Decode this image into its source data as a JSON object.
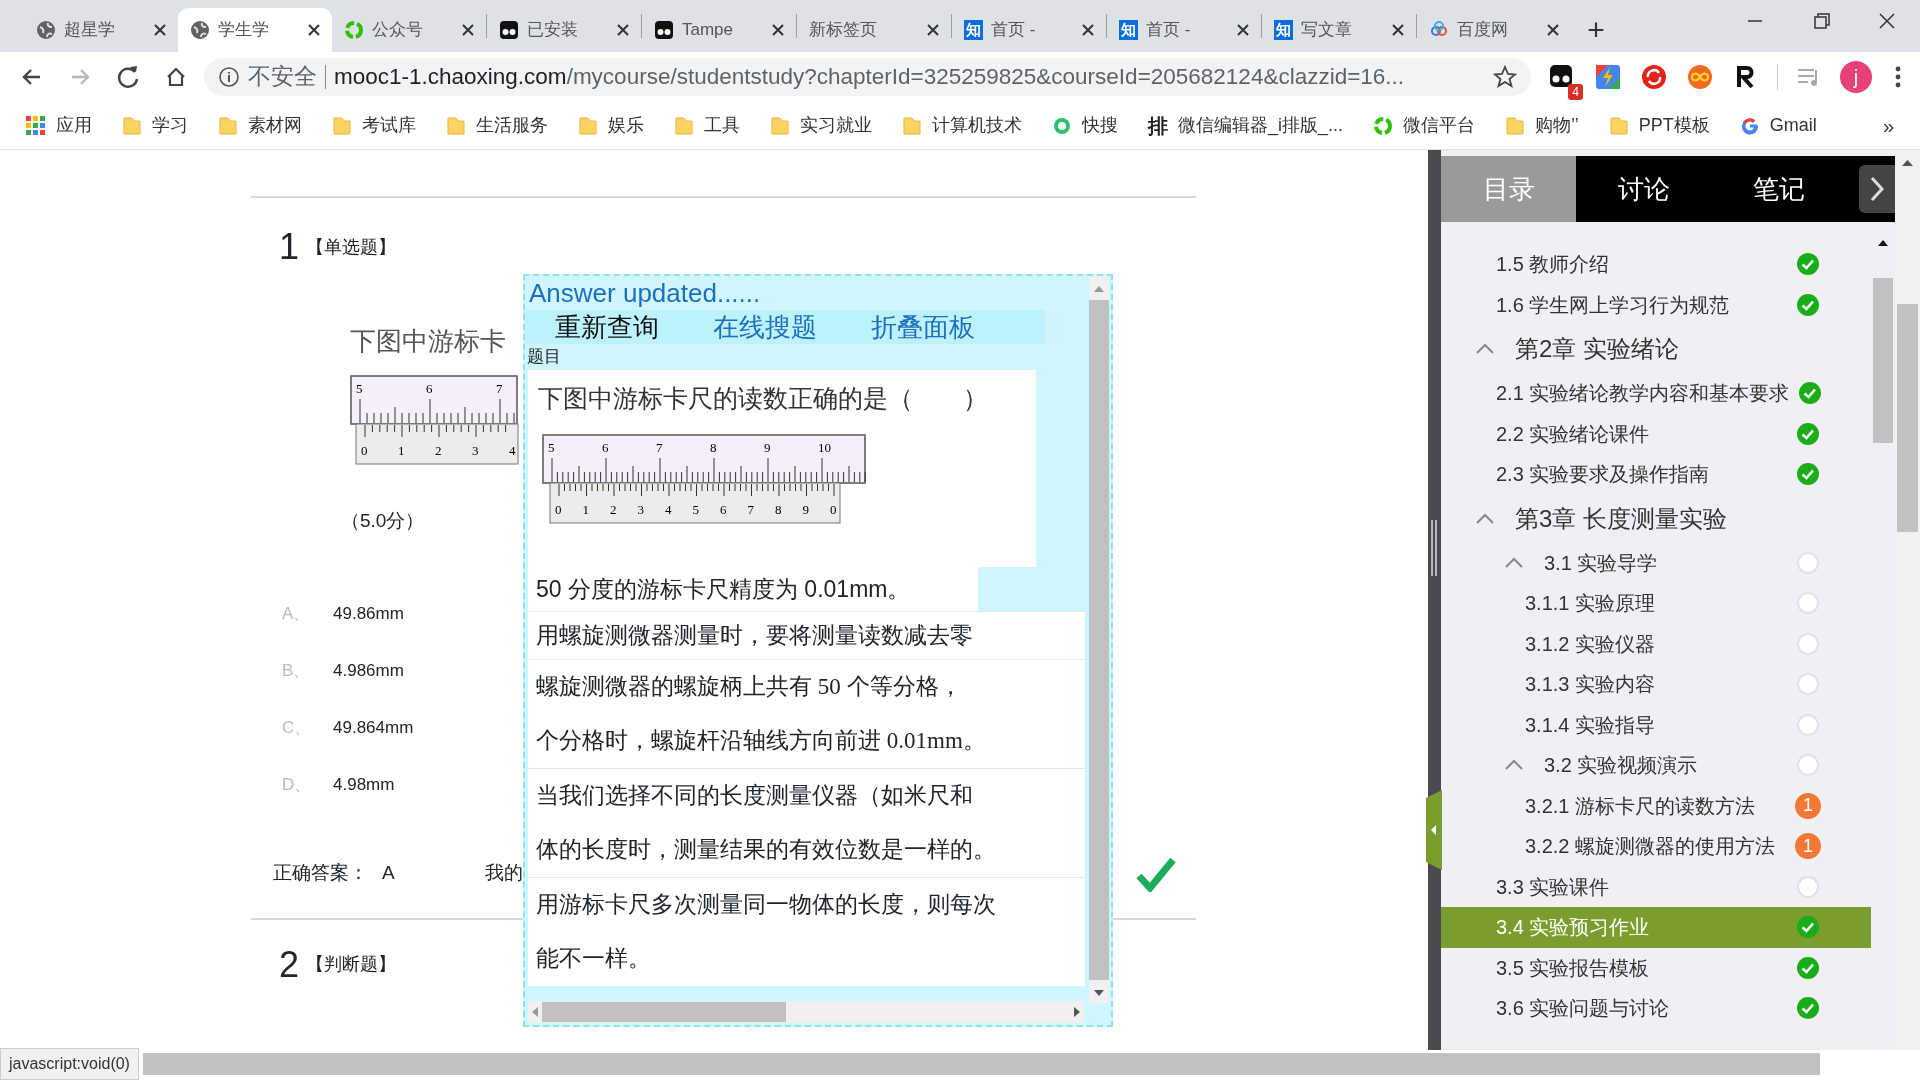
{
  "tabs": [
    {
      "title": "超星学",
      "kind": "globe",
      "selected": false
    },
    {
      "title": "学生学",
      "kind": "globe",
      "selected": true
    },
    {
      "title": "公众号",
      "kind": "ring",
      "selected": false
    },
    {
      "title": "已安装",
      "kind": "monkey",
      "selected": false
    },
    {
      "title": "Tampe",
      "kind": "monkey",
      "selected": false
    },
    {
      "title": "新标签页",
      "kind": "blank",
      "selected": false
    },
    {
      "title": "首页 -",
      "kind": "lettermark",
      "mark": "知",
      "selected": false
    },
    {
      "title": "首页 -",
      "kind": "lettermark",
      "mark": "知",
      "selected": false
    },
    {
      "title": "写文章",
      "kind": "lettermark",
      "mark": "知",
      "selected": false
    },
    {
      "title": "百度网",
      "kind": "cloud",
      "selected": false
    }
  ],
  "new_tab": "+",
  "toolbar": {
    "forward_disabled": true,
    "security": "不安全",
    "url_host": "mooc1-1.chaoxing.com",
    "url_path": "/mycourse/studentstudy?chapterId=325259825&courseId=205682124&clazzid=16...",
    "extensions": [
      {
        "kind": "monkey",
        "badge": "4"
      },
      {
        "kind": "bolt"
      },
      {
        "kind": "sync"
      },
      {
        "kind": "infinity"
      },
      {
        "kind": "rlogo"
      }
    ],
    "avatar": "j"
  },
  "bookmarks": [
    {
      "label": "应用",
      "kind": "apps"
    },
    {
      "label": "学习",
      "kind": "folder"
    },
    {
      "label": "素材网",
      "kind": "folder"
    },
    {
      "label": "考试库",
      "kind": "folder"
    },
    {
      "label": "生活服务",
      "kind": "folder"
    },
    {
      "label": "娱乐",
      "kind": "folder"
    },
    {
      "label": "工具",
      "kind": "folder"
    },
    {
      "label": "实习就业",
      "kind": "folder"
    },
    {
      "label": "计算机技术",
      "kind": "folder"
    },
    {
      "label": "快搜",
      "kind": "search"
    },
    {
      "label": "微信编辑器_i排版_...",
      "kind": "glyph",
      "mark": "排"
    },
    {
      "label": "微信平台",
      "kind": "ring"
    },
    {
      "label": "购物’’",
      "kind": "folder"
    },
    {
      "label": "PPT模板",
      "kind": "folder"
    },
    {
      "label": "Gmail",
      "kind": "google"
    }
  ],
  "bookmarks_more": "»",
  "question": {
    "number": "1",
    "type": "【单选题】",
    "text": "下图中游标卡",
    "ruler": {
      "main": [
        "5",
        "6",
        "7"
      ],
      "vernier": [
        "0",
        "1",
        "2",
        "3",
        "4"
      ]
    },
    "score": "（5.0分）",
    "options": [
      {
        "letter": "A、",
        "text": "49.86mm"
      },
      {
        "letter": "B、",
        "text": "4.986mm"
      },
      {
        "letter": "C、",
        "text": "49.864mm"
      },
      {
        "letter": "D、",
        "text": "4.98mm"
      }
    ],
    "answer_label": "正确答案：",
    "answer": "A",
    "mine_label": "我的",
    "correct": true
  },
  "next_question": {
    "number": "2",
    "type": "【判断题】"
  },
  "popup": {
    "status": "Answer updated......",
    "buttons": [
      {
        "label": "重新查询",
        "kind": "plain"
      },
      {
        "label": "在线搜题",
        "kind": "link"
      },
      {
        "label": "折叠面板",
        "kind": "link"
      }
    ],
    "section": "题目",
    "question": "下图中游标卡尺的读数正确的是（　　）",
    "ruler": {
      "main": [
        "5",
        "6",
        "7",
        "8",
        "9",
        "10"
      ],
      "vernier": [
        "0",
        "1",
        "2",
        "3",
        "4",
        "5",
        "6",
        "7",
        "8",
        "9",
        "0"
      ]
    },
    "rows": [
      {
        "lines": [
          "50 分度的游标卡尺精度为 0.01mm。"
        ]
      },
      {
        "lines": [
          "用螺旋测微器测量时，要将测量读数减去零"
        ]
      },
      {
        "lines": [
          "螺旋测微器的螺旋柄上共有 50 个等分格，",
          "个分格时，螺旋杆沿轴线方向前进 0.01mm。"
        ]
      },
      {
        "lines": [
          "当我们选择不同的长度测量仪器（如米尺和",
          "体的长度时，测量结果的有效位数是一样的。"
        ]
      },
      {
        "lines": [
          "用游标卡尺多次测量同一物体的长度，则每次",
          "能不一样。"
        ]
      }
    ]
  },
  "sidebar": {
    "tabs": [
      {
        "label": "目录",
        "selected": true
      },
      {
        "label": "讨论",
        "selected": false
      },
      {
        "label": "笔记",
        "selected": false
      }
    ],
    "items": [
      {
        "label": "1.5 教师介绍",
        "completed": true,
        "selected": false
      },
      {
        "label": "1.6 学生网上学习行为规范",
        "completed": true,
        "selected": false
      },
      {
        "label": "第2章 实验绪论",
        "expanded": true,
        "children": [
          {
            "label": "2.1 实验绪论教学内容和基本要求",
            "completed": true,
            "selected": false
          },
          {
            "label": "2.2 实验绪论课件",
            "completed": true,
            "selected": false
          },
          {
            "label": "2.3 实验要求及操作指南",
            "completed": true,
            "selected": false
          }
        ]
      },
      {
        "label": "第3章 长度测量实验",
        "expanded": true,
        "children": [
          {
            "label": "3.1 实验导学",
            "completed": false,
            "selected": false,
            "expanded": true,
            "children": [
              {
                "label": "3.1.1 实验原理",
                "completed": false,
                "selected": false
              },
              {
                "label": "3.1.2 实验仪器",
                "completed": false,
                "selected": false
              },
              {
                "label": "3.1.3 实验内容",
                "completed": false,
                "selected": false
              },
              {
                "label": "3.1.4 实验指导",
                "completed": false,
                "selected": false
              }
            ]
          },
          {
            "label": "3.2 实验视频演示",
            "completed": false,
            "selected": false,
            "expanded": true,
            "children": [
              {
                "label": "3.2.1 游标卡尺的读数方法",
                "badge": "1",
                "selected": false
              },
              {
                "label": "3.2.2 螺旋测微器的使用方法",
                "badge": "1",
                "selected": false
              }
            ]
          },
          {
            "label": "3.3 实验课件",
            "completed": false,
            "selected": false
          },
          {
            "label": "3.4 实验预习作业",
            "completed": true,
            "selected": true
          },
          {
            "label": "3.5 实验报告模板",
            "completed": true,
            "selected": false
          },
          {
            "label": "3.6 实验问题与讨论",
            "completed": true,
            "selected": false
          }
        ]
      }
    ]
  },
  "status_bar": "javascript:void(0)"
}
